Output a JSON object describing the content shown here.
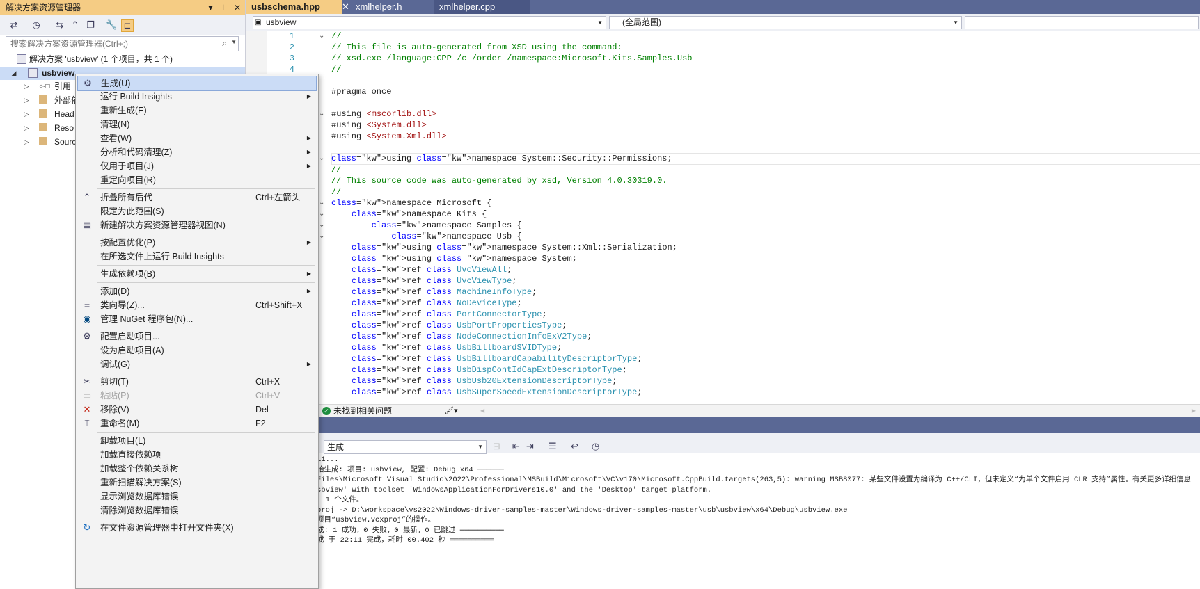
{
  "solution_explorer": {
    "title": "解决方案资源管理器",
    "search_placeholder": "搜索解决方案资源管理器(Ctrl+;)",
    "solution_label": "解决方案 'usbview' (1 个项目，共 1 个)",
    "project_label": "usbview",
    "tree_items": [
      "引用",
      "外部依",
      "Head",
      "Reso",
      "Sourc"
    ]
  },
  "editor": {
    "tabs": [
      "usbschema.hpp",
      "xmlhelper.h",
      "xmlhelper.cpp"
    ],
    "nav_project": "usbview",
    "nav_scope": "(全局范围)",
    "line_numbers": [
      "1",
      "2",
      "3",
      "4"
    ],
    "status_text": "未找到相关问题"
  },
  "output": {
    "source_select": "生成",
    "lines": [
      "11...",
      "始生成: 项目: usbview, 配置: Debug x64 ──────",
      "Files\\Microsoft Visual Studio\\2022\\Professional\\MSBuild\\Microsoft\\VC\\v170\\Microsoft.CppBuild.targets(263,5): warning MSB8077: 某些文件设置为编译为 C++/CLI，但未定义“为单个文件启用 CLR 支持”属性。有关更多详细信息",
      "sbview' with toolset 'WindowsApplicationForDrivers10.0' and the 'Desktop' target platform.",
      "  1 个文件。",
      "proj -> D:\\workspace\\vs2022\\Windows-driver-samples-master\\Windows-driver-samples-master\\usb\\usbview\\x64\\Debug\\usbview.exe",
      "项目“usbview.vcxproj”的操作。",
      "成: 1 成功，0 失败，0 最新，0 已跳过 ══════════",
      "成 于 22:11 完成，耗时 00.402 秒 ══════════"
    ]
  },
  "context_menu": {
    "items": [
      {
        "label": "生成(U)",
        "shortcut": "",
        "submenu": false,
        "icon": "build-icon"
      },
      {
        "label": "运行 Build Insights",
        "shortcut": "",
        "submenu": true,
        "icon": ""
      },
      {
        "label": "重新生成(E)",
        "shortcut": "",
        "submenu": false,
        "icon": ""
      },
      {
        "label": "清理(N)",
        "shortcut": "",
        "submenu": false,
        "icon": ""
      },
      {
        "label": "查看(W)",
        "shortcut": "",
        "submenu": true,
        "icon": ""
      },
      {
        "label": "分析和代码清理(Z)",
        "shortcut": "",
        "submenu": true,
        "icon": ""
      },
      {
        "label": "仅用于项目(J)",
        "shortcut": "",
        "submenu": true,
        "icon": ""
      },
      {
        "label": "重定向项目(R)",
        "shortcut": "",
        "submenu": false,
        "icon": ""
      },
      {
        "label": "折叠所有后代",
        "shortcut": "Ctrl+左箭头",
        "submenu": false,
        "icon": "collapse-icon"
      },
      {
        "label": "限定为此范围(S)",
        "shortcut": "",
        "submenu": false,
        "icon": ""
      },
      {
        "label": "新建解决方案资源管理器视图(N)",
        "shortcut": "",
        "submenu": false,
        "icon": "new-view-icon"
      },
      {
        "label": "按配置优化(P)",
        "shortcut": "",
        "submenu": true,
        "icon": ""
      },
      {
        "label": "在所选文件上运行 Build Insights",
        "shortcut": "",
        "submenu": false,
        "icon": ""
      },
      {
        "label": "生成依赖项(B)",
        "shortcut": "",
        "submenu": true,
        "icon": ""
      },
      {
        "label": "添加(D)",
        "shortcut": "",
        "submenu": true,
        "icon": ""
      },
      {
        "label": "类向导(Z)...",
        "shortcut": "Ctrl+Shift+X",
        "submenu": false,
        "icon": "class-wizard-icon"
      },
      {
        "label": "管理 NuGet 程序包(N)...",
        "shortcut": "",
        "submenu": false,
        "icon": "nuget-icon"
      },
      {
        "label": "配置启动项目...",
        "shortcut": "",
        "submenu": false,
        "icon": "gear-icon"
      },
      {
        "label": "设为启动项目(A)",
        "shortcut": "",
        "submenu": false,
        "icon": ""
      },
      {
        "label": "调试(G)",
        "shortcut": "",
        "submenu": true,
        "icon": ""
      },
      {
        "label": "剪切(T)",
        "shortcut": "Ctrl+X",
        "submenu": false,
        "icon": "scissors-icon"
      },
      {
        "label": "粘贴(P)",
        "shortcut": "Ctrl+V",
        "submenu": false,
        "icon": "paste-icon",
        "disabled": true
      },
      {
        "label": "移除(V)",
        "shortcut": "Del",
        "submenu": false,
        "icon": "remove-icon"
      },
      {
        "label": "重命名(M)",
        "shortcut": "F2",
        "submenu": false,
        "icon": "rename-icon"
      },
      {
        "label": "卸载项目(L)",
        "shortcut": "",
        "submenu": false,
        "icon": ""
      },
      {
        "label": "加载直接依赖项",
        "shortcut": "",
        "submenu": false,
        "icon": ""
      },
      {
        "label": "加载整个依赖关系树",
        "shortcut": "",
        "submenu": false,
        "icon": ""
      },
      {
        "label": "重新扫描解决方案(S)",
        "shortcut": "",
        "submenu": false,
        "icon": ""
      },
      {
        "label": "显示浏览数据库错误",
        "shortcut": "",
        "submenu": false,
        "icon": ""
      },
      {
        "label": "清除浏览数据库错误",
        "shortcut": "",
        "submenu": false,
        "icon": ""
      },
      {
        "label": "在文件资源管理器中打开文件夹(X)",
        "shortcut": "",
        "submenu": false,
        "icon": "refresh-folder-icon"
      }
    ]
  },
  "code_lines": [
    "//",
    "// This file is auto-generated from XSD using the command:",
    "// xsd.exe /language:CPP /c /order /namespace:Microsoft.Kits.Samples.Usb",
    "//",
    "",
    "#pragma once",
    "",
    "#using <mscorlib.dll>",
    "#using <System.dll>",
    "#using <System.Xml.dll>",
    "",
    "using namespace System::Security::Permissions;",
    "//",
    "// This source code was auto-generated by xsd, Version=4.0.30319.0.",
    "//",
    "namespace Microsoft {",
    "    namespace Kits {",
    "        namespace Samples {",
    "            namespace Usb {",
    "    using namespace System::Xml::Serialization;",
    "    using namespace System;",
    "    ref class UvcViewAll;",
    "    ref class UvcViewType;",
    "    ref class MachineInfoType;",
    "    ref class NoDeviceType;",
    "    ref class PortConnectorType;",
    "    ref class UsbPortPropertiesType;",
    "    ref class NodeConnectionInfoExV2Type;",
    "    ref class UsbBillboardSVIDType;",
    "    ref class UsbBillboardCapabilityDescriptorType;",
    "    ref class UsbDispContIdCapExtDescriptorType;",
    "    ref class UsbUsb20ExtensionDescriptorType;",
    "    ref class UsbSuperSpeedExtensionDescriptorType;"
  ],
  "colors": {
    "tab_bar": "#5a6895",
    "active_tab": "#f5cc84",
    "menu_highlight": "#cbdcf6",
    "keyword": "#0000ff",
    "comment": "#008000",
    "string": "#a31515",
    "type": "#2b91af"
  }
}
